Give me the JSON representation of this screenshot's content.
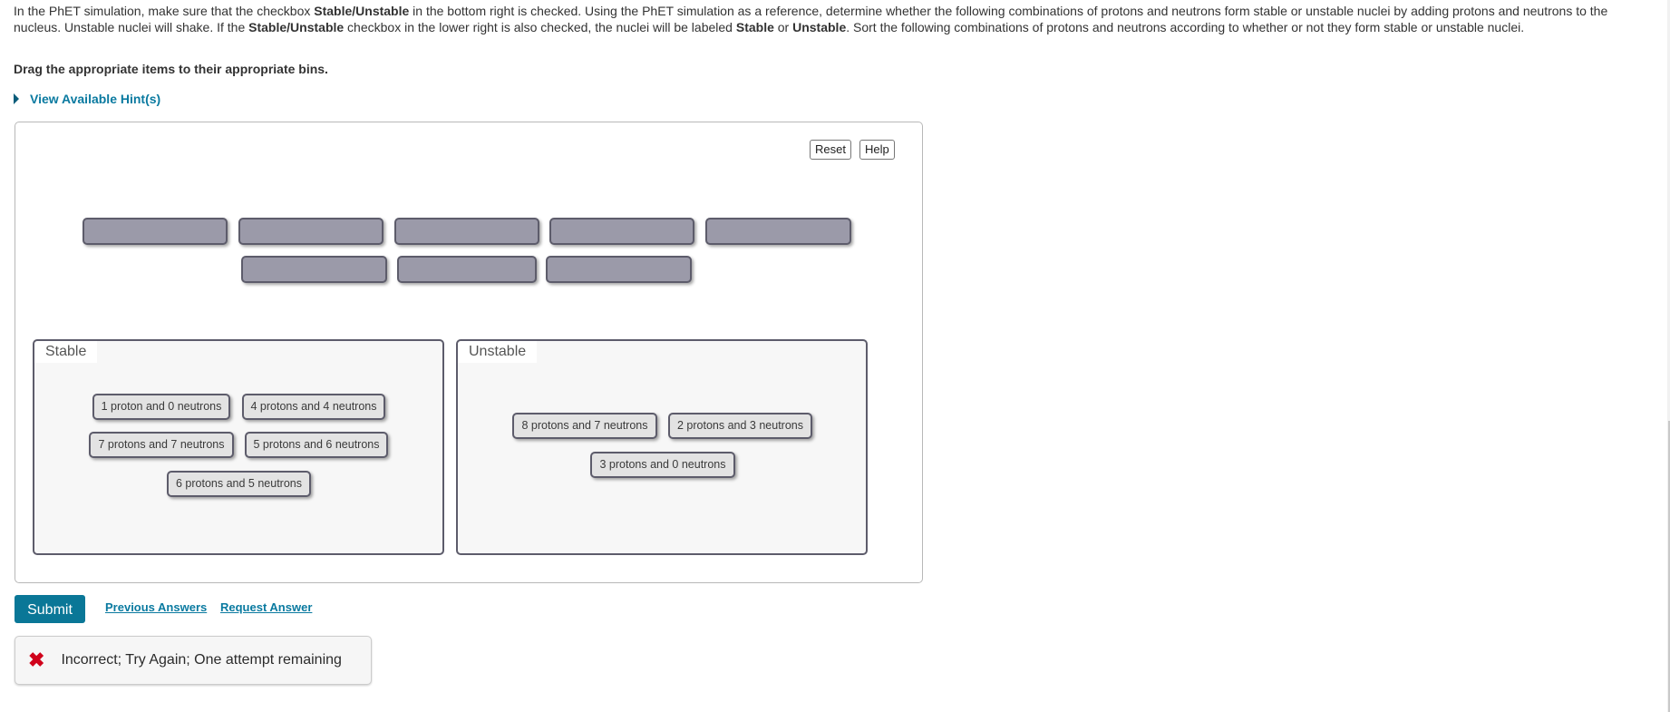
{
  "instructions": {
    "p1": "In the PhET simulation, make sure that the checkbox ",
    "b1": "Stable/Unstable",
    "p2": " in the bottom right is checked. Using the PhET simulation as a reference, determine whether the following combinations of protons and neutrons form stable or unstable nuclei by adding protons and neutrons to the nucleus. Unstable nuclei will shake. If the ",
    "b2": "Stable/Unstable",
    "p3": " checkbox in the lower right is also checked, the nuclei will be labeled ",
    "b3": "Stable",
    "p4": " or ",
    "b4": "Unstable",
    "p5": ". Sort the following combinations of protons and neutrons according to whether or not they form stable or unstable nuclei."
  },
  "drag_instruction": "Drag the appropriate items to their appropriate bins.",
  "hint_link": "View Available Hint(s)",
  "toolbar": {
    "reset_label": "Reset",
    "help_label": "Help"
  },
  "source_area": {
    "empty_slots": 8
  },
  "bins": [
    {
      "label": "Stable",
      "items": [
        "1 proton and 0 neutrons",
        "4 protons and 4 neutrons",
        "7 protons and 7 neutrons",
        "5 protons and 6 neutrons",
        "6 protons and 5 neutrons"
      ]
    },
    {
      "label": "Unstable",
      "items": [
        "8 protons and 7 neutrons",
        "2 protons and 3 neutrons",
        "3 protons and 0 neutrons"
      ]
    }
  ],
  "actions": {
    "submit_label": "Submit",
    "previous_answers_label": "Previous Answers",
    "request_answer_label": "Request Answer"
  },
  "feedback": {
    "icon": "x-mark-icon",
    "message": "Incorrect; Try Again; One attempt remaining",
    "icon_color": "#d0021b"
  },
  "colors": {
    "accent": "#0a7797",
    "link": "#0a7aa0",
    "slot_fill": "#9b9aa9",
    "chip_fill": "#e3e3e3"
  }
}
